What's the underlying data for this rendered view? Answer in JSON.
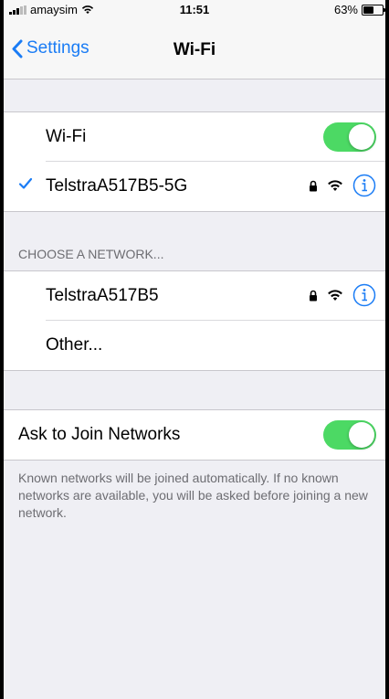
{
  "status_bar": {
    "carrier": "amaysim",
    "time": "11:51",
    "battery": "63%",
    "battery_level": 0.63
  },
  "nav": {
    "back_label": "Settings",
    "title": "Wi-Fi"
  },
  "wifi_group": {
    "wifi_label": "Wi-Fi",
    "wifi_enabled": true,
    "connected_network": "TelstraA517B5-5G"
  },
  "choose_section": {
    "header": "CHOOSE A NETWORK...",
    "networks": [
      {
        "name": "TelstraA517B5"
      }
    ],
    "other_label": "Other..."
  },
  "ask_group": {
    "label": "Ask to Join Networks",
    "enabled": true,
    "footnote": "Known networks will be joined automatically. If no known networks are available, you will be asked before joining a new network."
  },
  "icons": {
    "back": "chevron-left-icon",
    "check": "checkmark-icon",
    "lock": "lock-icon",
    "wifi": "wifi-signal-icon",
    "info": "info-icon"
  },
  "colors": {
    "accent": "#1a7cf5",
    "toggle_on": "#4cd964",
    "background": "#efeff4"
  }
}
